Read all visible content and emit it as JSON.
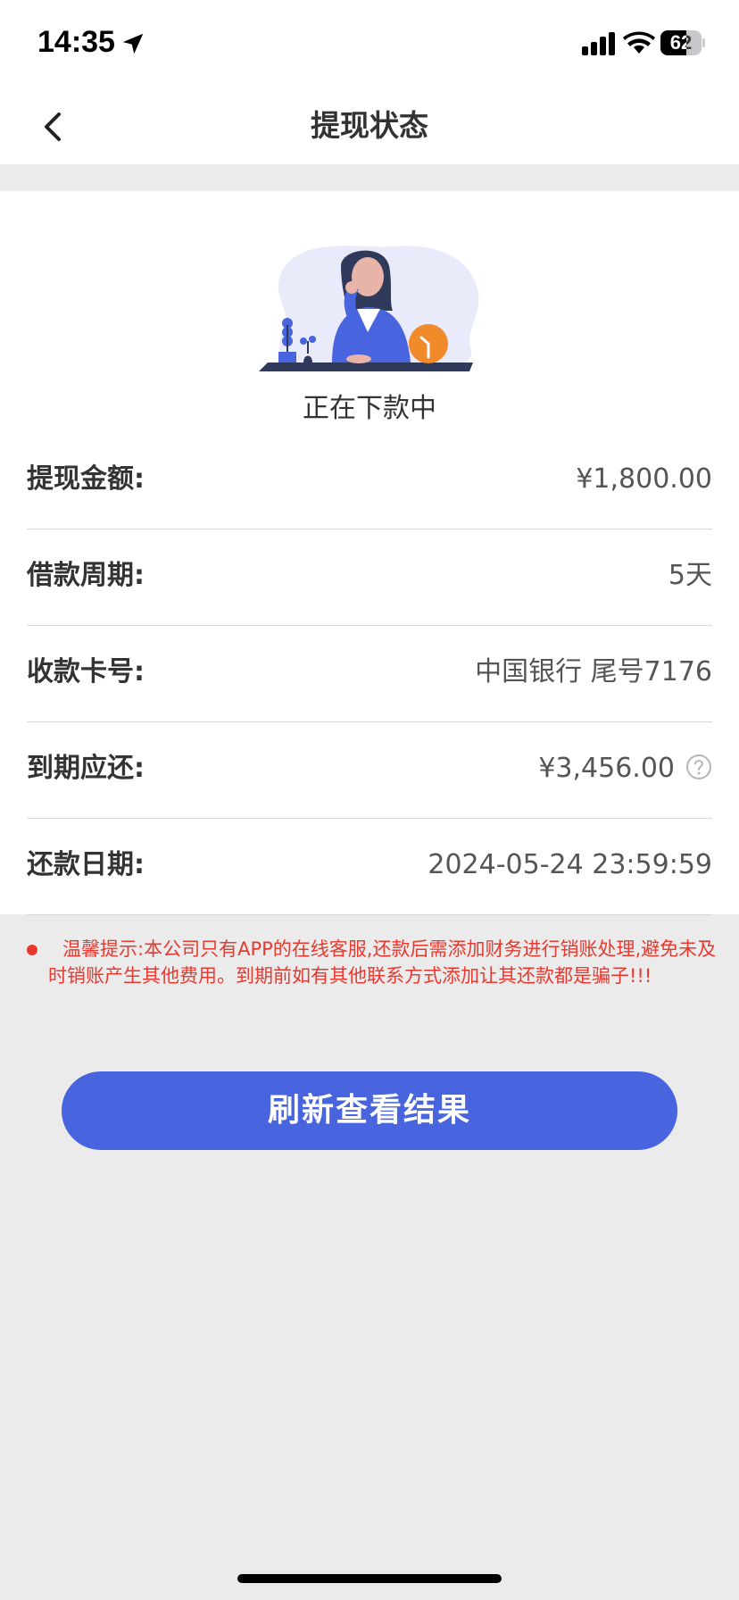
{
  "status_bar": {
    "time": "14:35",
    "battery_level": "62",
    "battery_fraction": 0.62,
    "icons": [
      "location-arrow-icon",
      "signal-icon",
      "wifi-icon",
      "battery-icon"
    ]
  },
  "nav": {
    "title": "提现状态",
    "back_icon": "chevron-left-icon"
  },
  "status": {
    "text": "正在下款中",
    "illustration": "woman-waiting-clock-illustration"
  },
  "details": [
    {
      "label": "提现金额:",
      "value": "¥1,800.00"
    },
    {
      "label": "借款周期:",
      "value": "5天"
    },
    {
      "label": "收款卡号:",
      "value": "中国银行 尾号7176"
    },
    {
      "label": "到期应还:",
      "value": "¥3,456.00",
      "icon": "question-circle-icon"
    },
    {
      "label": "还款日期:",
      "value": "2024-05-24 23:59:59"
    }
  ],
  "notice": {
    "text": "温馨提示:本公司只有APP的在线客服,还款后需添加财务进行销账处理,避免未及时销账产生其他费用。到期前如有其他联系方式添加让其还款都是骗子!!!"
  },
  "actions": {
    "refresh_label": "刷新查看结果"
  },
  "colors": {
    "primary": "#4864de",
    "warning": "#e8392f",
    "background": "#ebebeb",
    "accent_orange": "#f08a2a"
  }
}
